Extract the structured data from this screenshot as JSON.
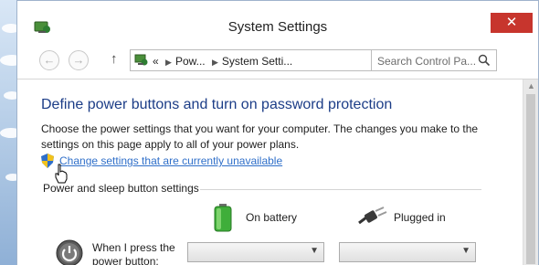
{
  "window": {
    "title": "System Settings",
    "close_glyph": "✕"
  },
  "navbar": {
    "back_glyph": "←",
    "forward_glyph": "→",
    "up_glyph": "↑",
    "breadcrumb": [
      "«",
      "Pow...",
      "System Setti..."
    ],
    "refresh_glyph": "↻",
    "search_placeholder": "Search Control Pa..."
  },
  "content": {
    "heading": "Define power buttons and turn on password protection",
    "description": "Choose the power settings that you want for your computer. The changes you make to the settings on this page apply to all of your power plans.",
    "change_link": "Change settings that are currently unavailable",
    "section_title": "Power and sleep button settings",
    "col_battery": "On battery",
    "col_plugged": "Plugged in",
    "row_power_button": "When I press the power button:"
  },
  "colors": {
    "heading": "#1c3d87",
    "link": "#2f6fc9",
    "close": "#c7352d"
  },
  "icons": [
    "control-panel-icon",
    "shield-icon",
    "hand-cursor-icon",
    "battery-icon",
    "plug-icon",
    "power-icon",
    "search-icon"
  ]
}
